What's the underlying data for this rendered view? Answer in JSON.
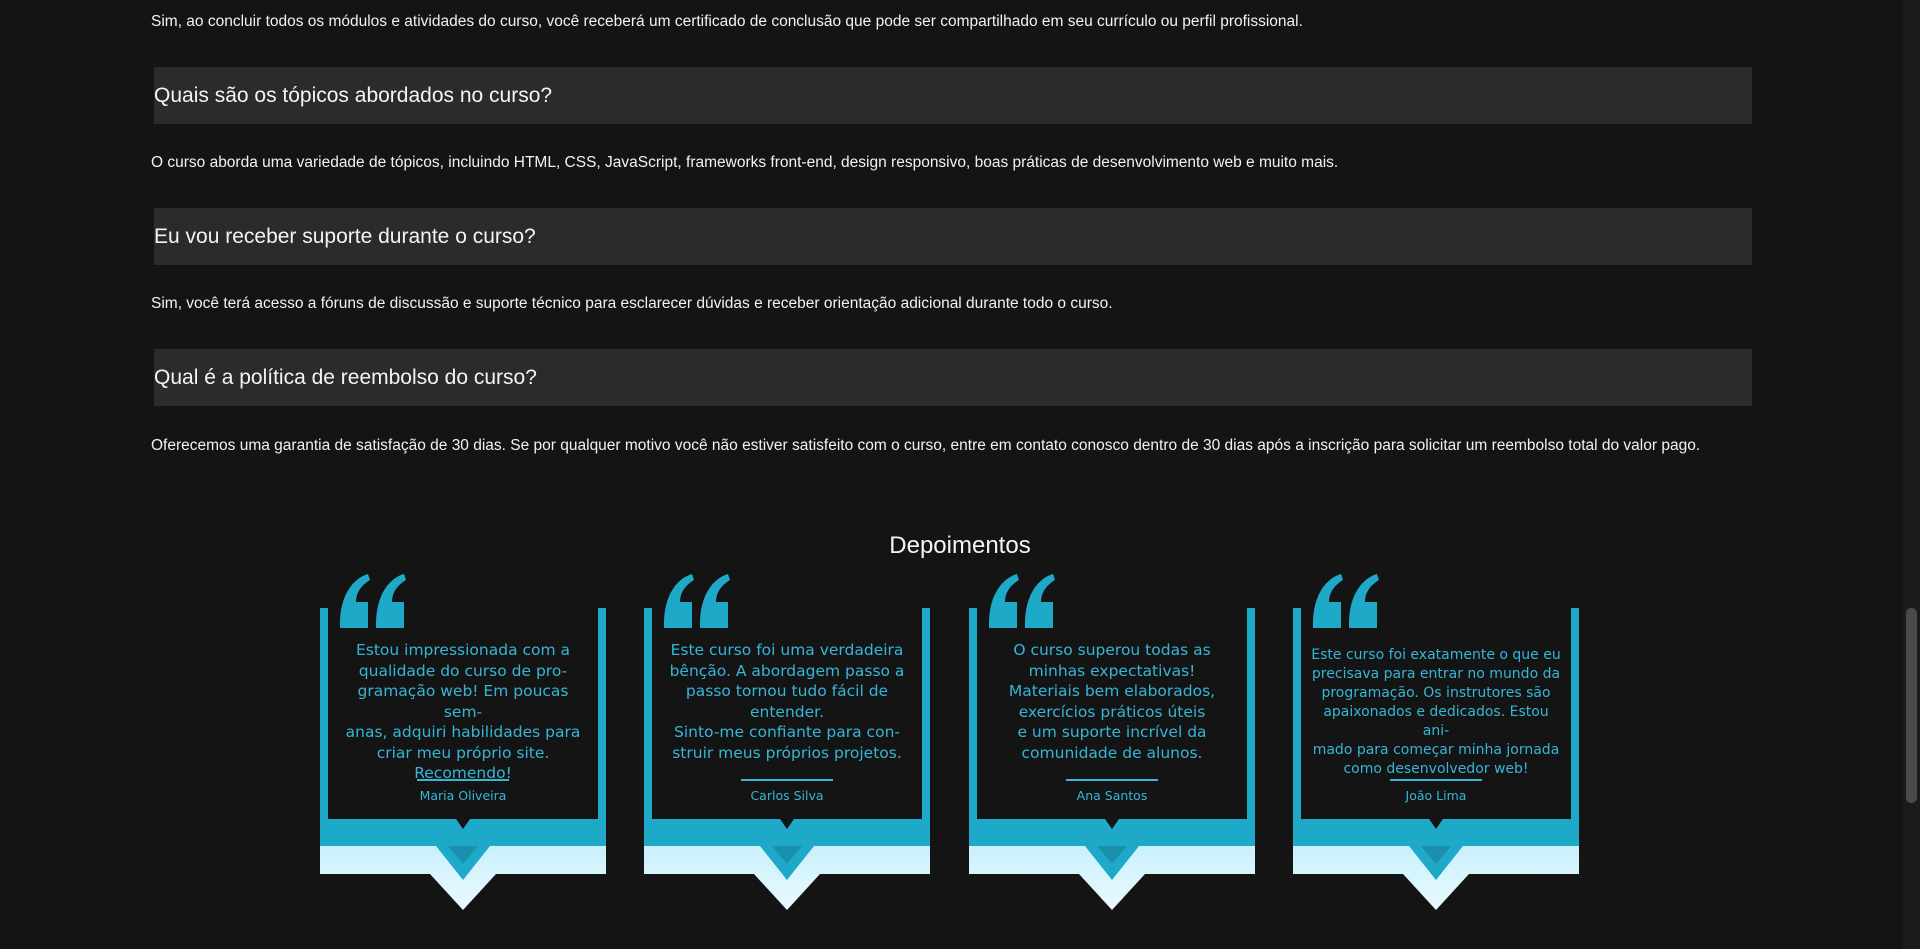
{
  "faq": [
    {
      "question": null,
      "answer": "Sim, ao concluir todos os módulos e atividades do curso, você receberá um certificado de conclusão que pode ser compartilhado em seu currículo ou perfil profissional."
    },
    {
      "question": "Quais são os tópicos abordados no curso?",
      "answer": "O curso aborda uma variedade de tópicos, incluindo HTML, CSS, JavaScript, frameworks front-end, design responsivo, boas práticas de desenvolvimento web e muito mais."
    },
    {
      "question": "Eu vou receber suporte durante o curso?",
      "answer": "Sim, você terá acesso a fóruns de discussão e suporte técnico para esclarecer dúvidas e receber orientação adicional durante todo o curso."
    },
    {
      "question": "Qual é a política de reembolso do curso?",
      "answer": "Oferecemos uma garantia de satisfação de 30 dias. Se por qualquer motivo você não estiver satisfeito com o curso, entre em contato conosco dentro de 30 dias após a inscrição para solicitar um reembolso total do valor pago."
    }
  ],
  "testimonials": {
    "title": "Depoimentos",
    "items": [
      {
        "quote": "Estou impressionada com a\nqualidade do curso de pro-\ngramação web! Em poucas sem-\nanas, adquiri habilidades para\ncriar meu próprio site.\nRecomendo!",
        "author": "Maria Oliveira"
      },
      {
        "quote": "Este curso foi uma verdadeira\nbênção. A abordagem passo a\npasso tornou tudo fácil de\nentender.\nSinto-me confiante para con-\nstruir meus próprios projetos.",
        "author": "Carlos Silva"
      },
      {
        "quote": "O curso superou todas as\nminhas expectativas!\nMateriais bem elaborados,\nexercícios práticos úteis\ne um suporte incrível da\ncomunidade de alunos.",
        "author": "Ana Santos"
      },
      {
        "quote": "Este curso foi exatamente o que eu\nprecisava para entrar no mundo da\nprogramação. Os instrutores são\napaixonados e dedicados. Estou ani-\nmado para começar minha jornada\ncomo desenvolvedor web!",
        "author": "João Lima"
      }
    ]
  },
  "colors": {
    "accent": "#35b6d6",
    "accent_dark": "#1fa9c9",
    "accent_light": "#c9f0fb",
    "background": "#141414",
    "question_bg": "#292b2c"
  }
}
